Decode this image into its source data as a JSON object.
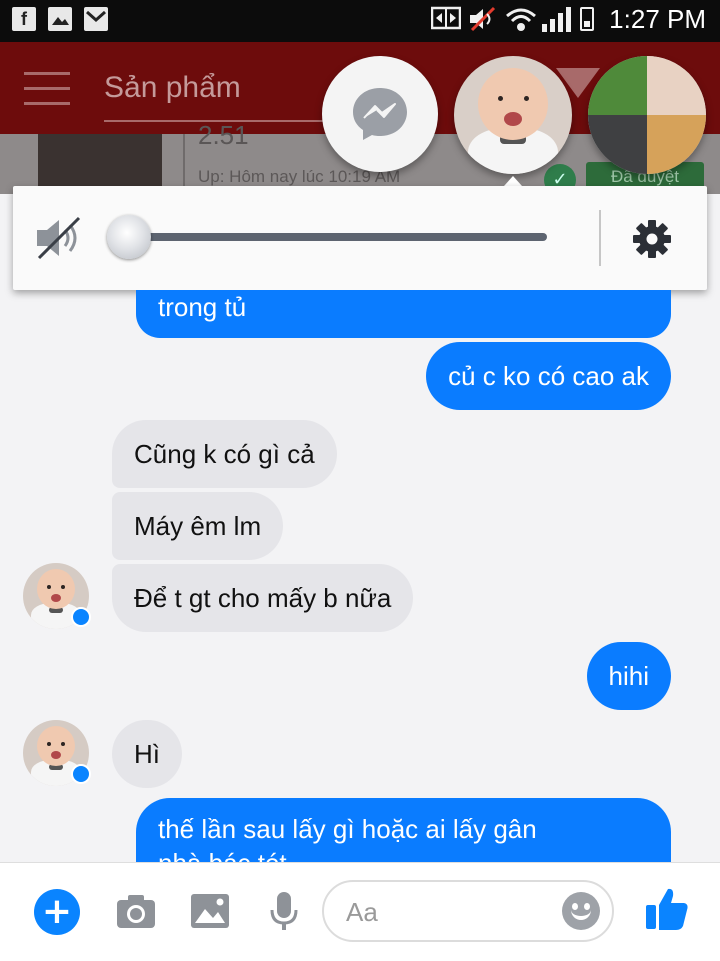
{
  "status_bar": {
    "notification_icons": [
      "facebook-icon",
      "gallery-icon",
      "gmail-icon"
    ],
    "system_icons": [
      "screen-mirroring-icon",
      "volume-muted-icon",
      "wifi-icon",
      "signal-icon",
      "battery-charging-icon"
    ],
    "time": "1:27 PM"
  },
  "background_app": {
    "title": "Sản phẩm",
    "product_name": "2.51",
    "updated_text": "Up: Hôm nay lúc 10:19 AM",
    "status_badge": "Đã duyệt",
    "header_color": "#6d0c0c"
  },
  "volume_panel": {
    "level_percent": 0,
    "muted": true,
    "icons": [
      "volume-muted-icon",
      "gear-icon"
    ]
  },
  "messages": [
    {
      "from": "me",
      "text": "trong tủ"
    },
    {
      "from": "me",
      "text": "củ c ko có cao ak"
    },
    {
      "from": "them",
      "text": "Cũng k có gì cả"
    },
    {
      "from": "them",
      "text": "Máy êm lm"
    },
    {
      "from": "them",
      "text": "Để t gt cho mấy b nữa"
    },
    {
      "from": "me",
      "text": "hihi"
    },
    {
      "from": "them",
      "text": "Hì"
    },
    {
      "from": "me",
      "text": "thế lần sau lấy gì hoặc ai lấy gân",
      "text_line2": "nhà bác tét"
    }
  ],
  "composer": {
    "placeholder": "Aa",
    "value": "",
    "icons": [
      "plus-icon",
      "camera-icon",
      "image-icon",
      "microphone-icon",
      "emoji-icon",
      "thumbs-up-icon"
    ]
  },
  "colors": {
    "outgoing_bubble": "#0a7cff",
    "incoming_bubble": "#e5e5e9",
    "accent": "#0a84ff"
  }
}
